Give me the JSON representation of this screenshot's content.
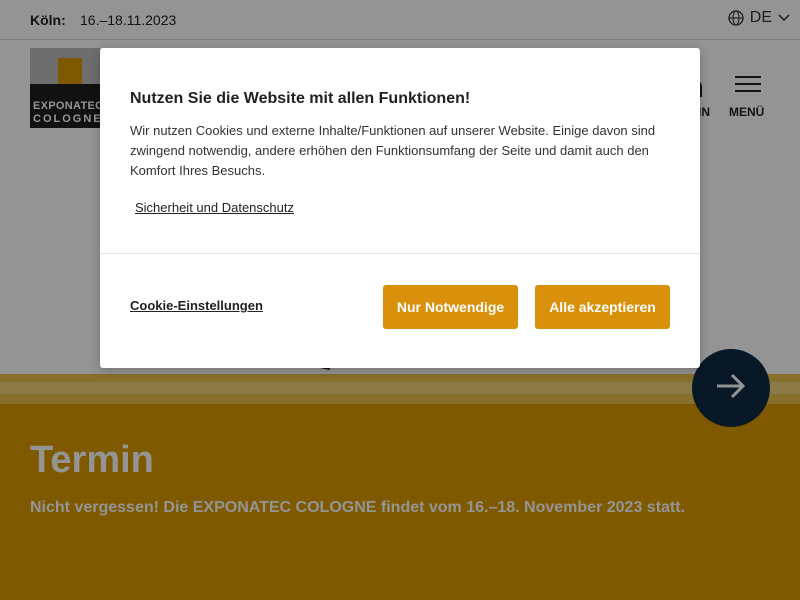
{
  "topbar": {
    "city_label": "Köln:",
    "dates": "16.–18.11.2023",
    "language": "DE"
  },
  "header": {
    "logo_line1": "EXPONATEC",
    "logo_line2": "COLOGNE",
    "login_label": "IN",
    "menu_label": "MENÜ"
  },
  "section": {
    "title": "Termin",
    "text": "Nicht vergessen! Die EXPONATEC COLOGNE findet vom 16.–18. November 2023 statt."
  },
  "cookie_dialog": {
    "title": "Nutzen Sie die Website mit allen Funktionen!",
    "body": "Wir nutzen Cookies und externe Inhalte/Funktionen auf unserer Website. Einige davon sind zwingend notwendig, andere erhöhen den Funktionsumfang der Seite und damit auch den Komfort Ihres Besuchs.",
    "privacy_link": "Sicherheit und Datenschutz",
    "settings_link": "Cookie-Einstellungen",
    "necessary_button": "Nur Notwendige",
    "accept_button": "Alle akzeptieren"
  },
  "colors": {
    "brand_gold": "#d99a00",
    "button_gold": "#d9900a",
    "fab_navy": "#102a43"
  },
  "icons": {
    "language": "globe-icon",
    "dropdown": "chevron-down-icon",
    "menu": "hamburger-icon",
    "next": "arrow-right-icon"
  }
}
